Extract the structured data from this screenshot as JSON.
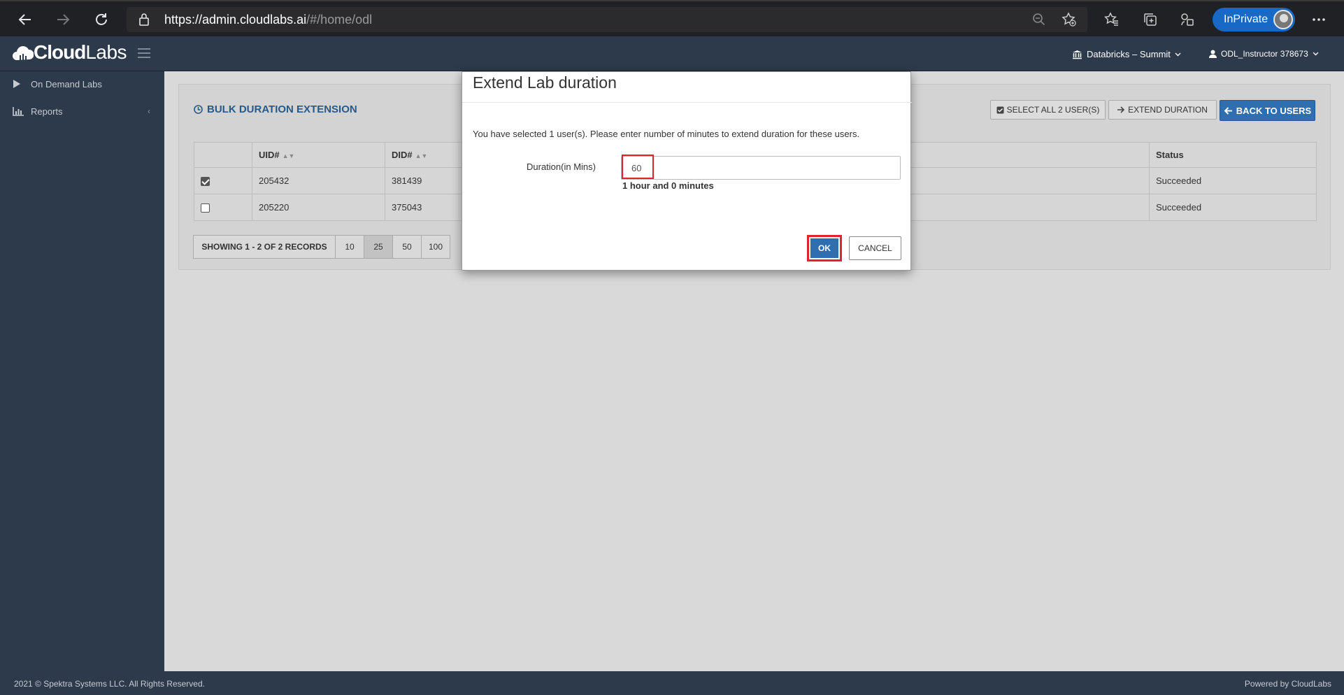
{
  "browser": {
    "url_host": "https://admin.cloudlabs.ai",
    "url_path": "/#/home/odl",
    "inprivate_label": "InPrivate"
  },
  "app": {
    "logo_bold": "Cloud",
    "logo_light": "Labs",
    "org_label": "Databricks – Summit",
    "user_label": "ODL_Instructor 378673"
  },
  "sidebar": {
    "items": [
      {
        "label": "On Demand Labs",
        "icon": "play-icon"
      },
      {
        "label": "Reports",
        "icon": "bar-chart-icon"
      }
    ]
  },
  "panel": {
    "title": "BULK DURATION EXTENSION",
    "select_all_label": "SELECT ALL 2 USER(S)",
    "extend_label": "EXTEND DURATION",
    "back_label": "BACK TO USERS"
  },
  "table": {
    "headers": [
      "",
      "UID#",
      "DID#",
      "Status"
    ],
    "rows": [
      {
        "checked": true,
        "uid": "205432",
        "did": "381439",
        "status": "Succeeded"
      },
      {
        "checked": false,
        "uid": "205220",
        "did": "375043",
        "status": "Succeeded"
      }
    ]
  },
  "pager": {
    "info": "SHOWING 1 - 2 OF 2 RECORDS",
    "sizes": [
      "10",
      "25",
      "50",
      "100"
    ],
    "active": "25"
  },
  "modal": {
    "title": "Extend Lab duration",
    "message": "You have selected 1 user(s). Please enter number of minutes to extend duration for these users.",
    "duration_label": "Duration(in Mins)",
    "duration_value": "60",
    "hint": "1 hour and 0 minutes",
    "ok_label": "OK",
    "cancel_label": "CANCEL"
  },
  "footer": {
    "copyright": "2021 © Spektra Systems LLC. All Rights Reserved.",
    "powered": "Powered by CloudLabs"
  },
  "colors": {
    "header_bg": "#2d3a4b",
    "primary": "#2f6eaf",
    "title_blue": "#27598a",
    "highlight_red": "#e0232d"
  }
}
